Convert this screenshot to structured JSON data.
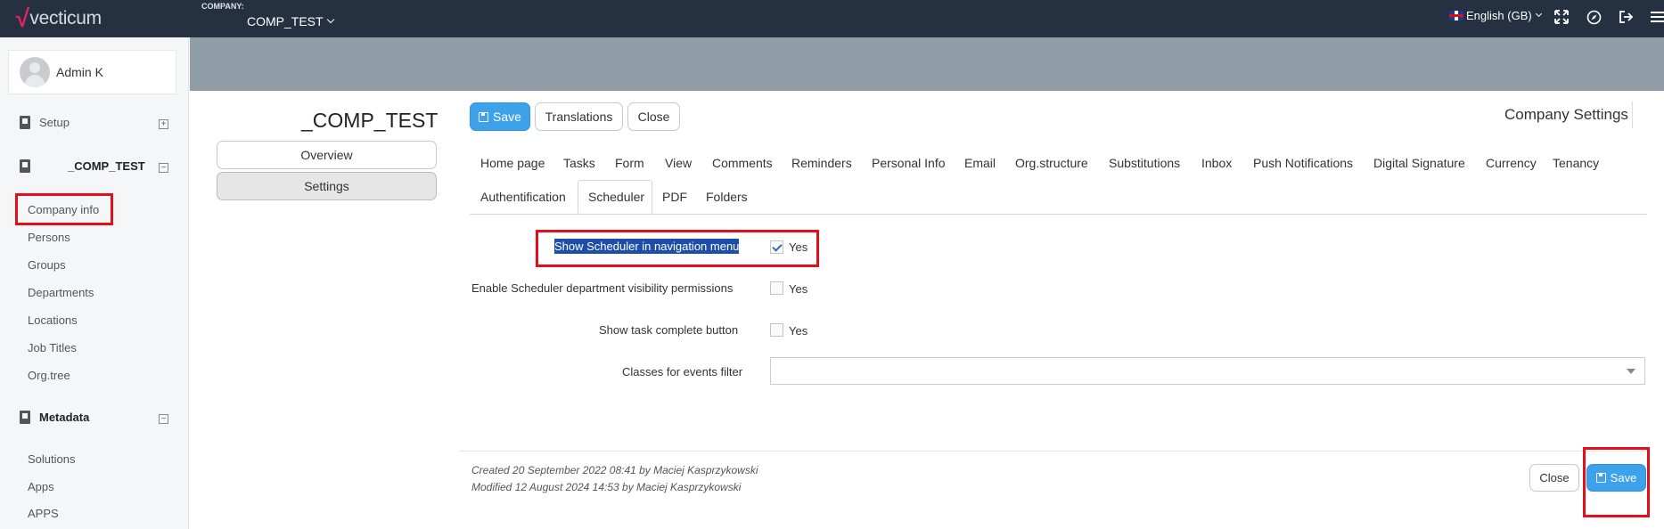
{
  "header": {
    "logo_text": "vecticum",
    "company_label": "COMPANY:",
    "company_value": "COMP_TEST",
    "language": "English (GB)",
    "icons": [
      "fullscreen-icon",
      "compass-icon",
      "logout-icon",
      "menu-icon"
    ]
  },
  "sidebar": {
    "user_name": "Admin K",
    "sections": [
      {
        "label": "Setup",
        "icon": "building-icon",
        "toggle": "+"
      },
      {
        "label": "_COMP_TEST",
        "icon": "building-icon",
        "toggle": "−"
      },
      {
        "label": "Metadata",
        "icon": "building-icon",
        "toggle": "−"
      }
    ],
    "company_links": [
      "Company info",
      "Persons",
      "Groups",
      "Departments",
      "Locations",
      "Job Titles",
      "Org.tree"
    ],
    "metadata_links": [
      "Solutions",
      "Apps",
      "APPS"
    ]
  },
  "main": {
    "entity_title": "_COMP_TEST",
    "left_nav": [
      "Overview",
      "Settings"
    ],
    "toolbar": {
      "save": "Save",
      "translations": "Translations",
      "close": "Close"
    },
    "page_heading": "Company Settings",
    "tabs_row1": [
      "Home page",
      "Tasks",
      "Form",
      "View",
      "Comments",
      "Reminders",
      "Personal Info",
      "Email",
      "Org.structure",
      "Substitutions",
      "Inbox",
      "Push Notifications",
      "Digital Signature",
      "Currency",
      "Tenancy"
    ],
    "tabs_row2": [
      "Authentification",
      "Scheduler",
      "PDF",
      "Folders"
    ],
    "active_tab": "Scheduler",
    "form": {
      "show_scheduler_label": "Show Scheduler in navigation menu",
      "show_scheduler_value": "Yes",
      "show_scheduler_checked": true,
      "dept_visibility_label": "Enable Scheduler department visibility permissions",
      "dept_visibility_value": "Yes",
      "dept_visibility_checked": false,
      "task_complete_label": "Show task complete button",
      "task_complete_value": "Yes",
      "task_complete_checked": false,
      "classes_filter_label": "Classes for events filter",
      "classes_filter_value": ""
    },
    "footer": {
      "created": "Created 20 September 2022 08:41 by Maciej Kasprzykowski",
      "modified": "Modified 12 August 2024 14:53 by Maciej Kasprzykowski",
      "close": "Close",
      "save": "Save"
    },
    "colors": {
      "primary": "#3ea1ec",
      "topbar": "#253141",
      "band": "#909ea8",
      "highlight": "#e3101c"
    }
  }
}
